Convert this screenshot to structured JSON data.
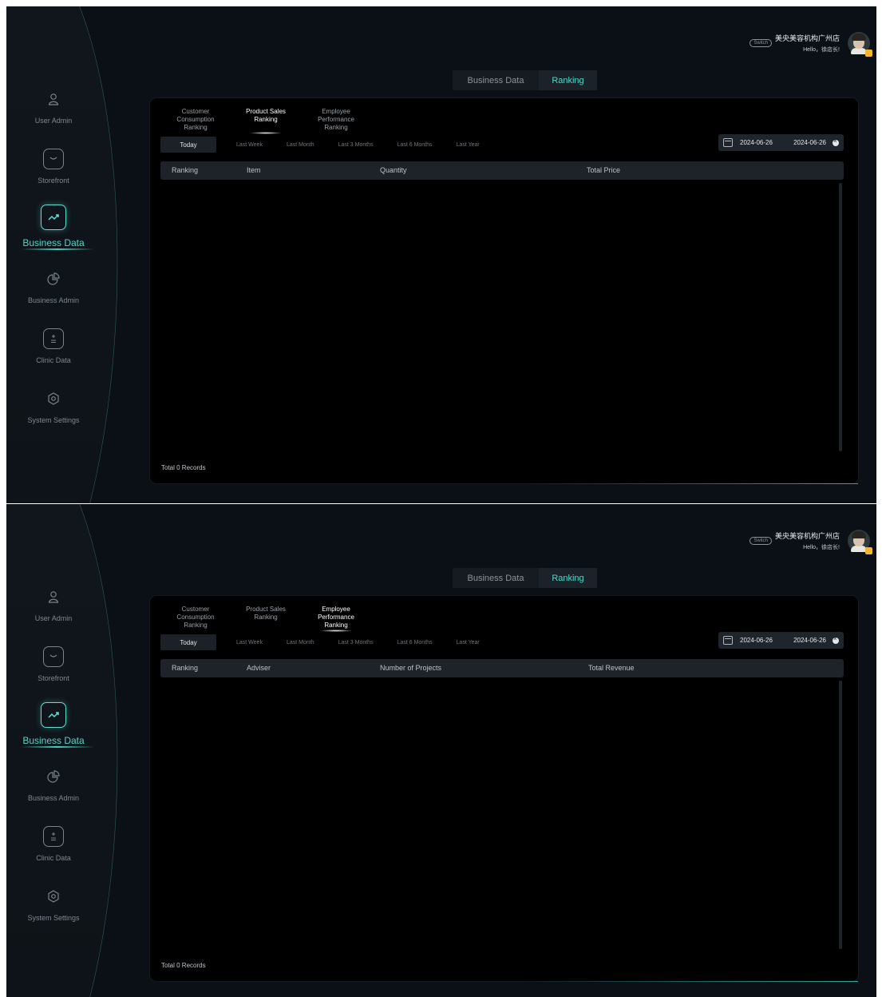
{
  "sidebar": {
    "items": [
      {
        "label": "User Admin",
        "icon": "user-icon"
      },
      {
        "label": "Storefront",
        "icon": "shop-bag-icon"
      },
      {
        "label": "Business Data",
        "icon": "trend-chart-icon",
        "active": true
      },
      {
        "label": "Business Admin",
        "icon": "pie-chart-icon"
      },
      {
        "label": "Clinic Data",
        "icon": "calculator-icon"
      },
      {
        "label": "System Settings",
        "icon": "hexagon-gear-icon"
      }
    ]
  },
  "header": {
    "switch_label": "Switch",
    "store_name": "美央美容机构广州店",
    "greeting": "Hello，徐店长!"
  },
  "top_tabs": [
    "Business Data",
    "Ranking"
  ],
  "sub_tabs": [
    [
      "Customer",
      "Consumption",
      "Ranking"
    ],
    [
      "Product Sales",
      "Ranking"
    ],
    [
      "Employee",
      "Performance",
      "Ranking"
    ]
  ],
  "time_filters": [
    "Today",
    "Last Week",
    "Last Month",
    "Last 3 Months",
    "Last 6 Months",
    "Last Year"
  ],
  "date_range": {
    "start": "2024-06-26",
    "end": "2024-06-26"
  },
  "screens": [
    {
      "active_sub_tab": 1,
      "columns": [
        "Ranking",
        "Item",
        "Quantity",
        "Total Price"
      ],
      "total": "Total 0 Records"
    },
    {
      "active_sub_tab": 2,
      "columns": [
        "Ranking",
        "Adviser",
        "Number of Projects",
        "Total Revenue"
      ],
      "total": "Total 0 Records"
    }
  ],
  "colors": {
    "accent": "#53d8cb",
    "background": "#0b1016",
    "panel": "#000000"
  }
}
